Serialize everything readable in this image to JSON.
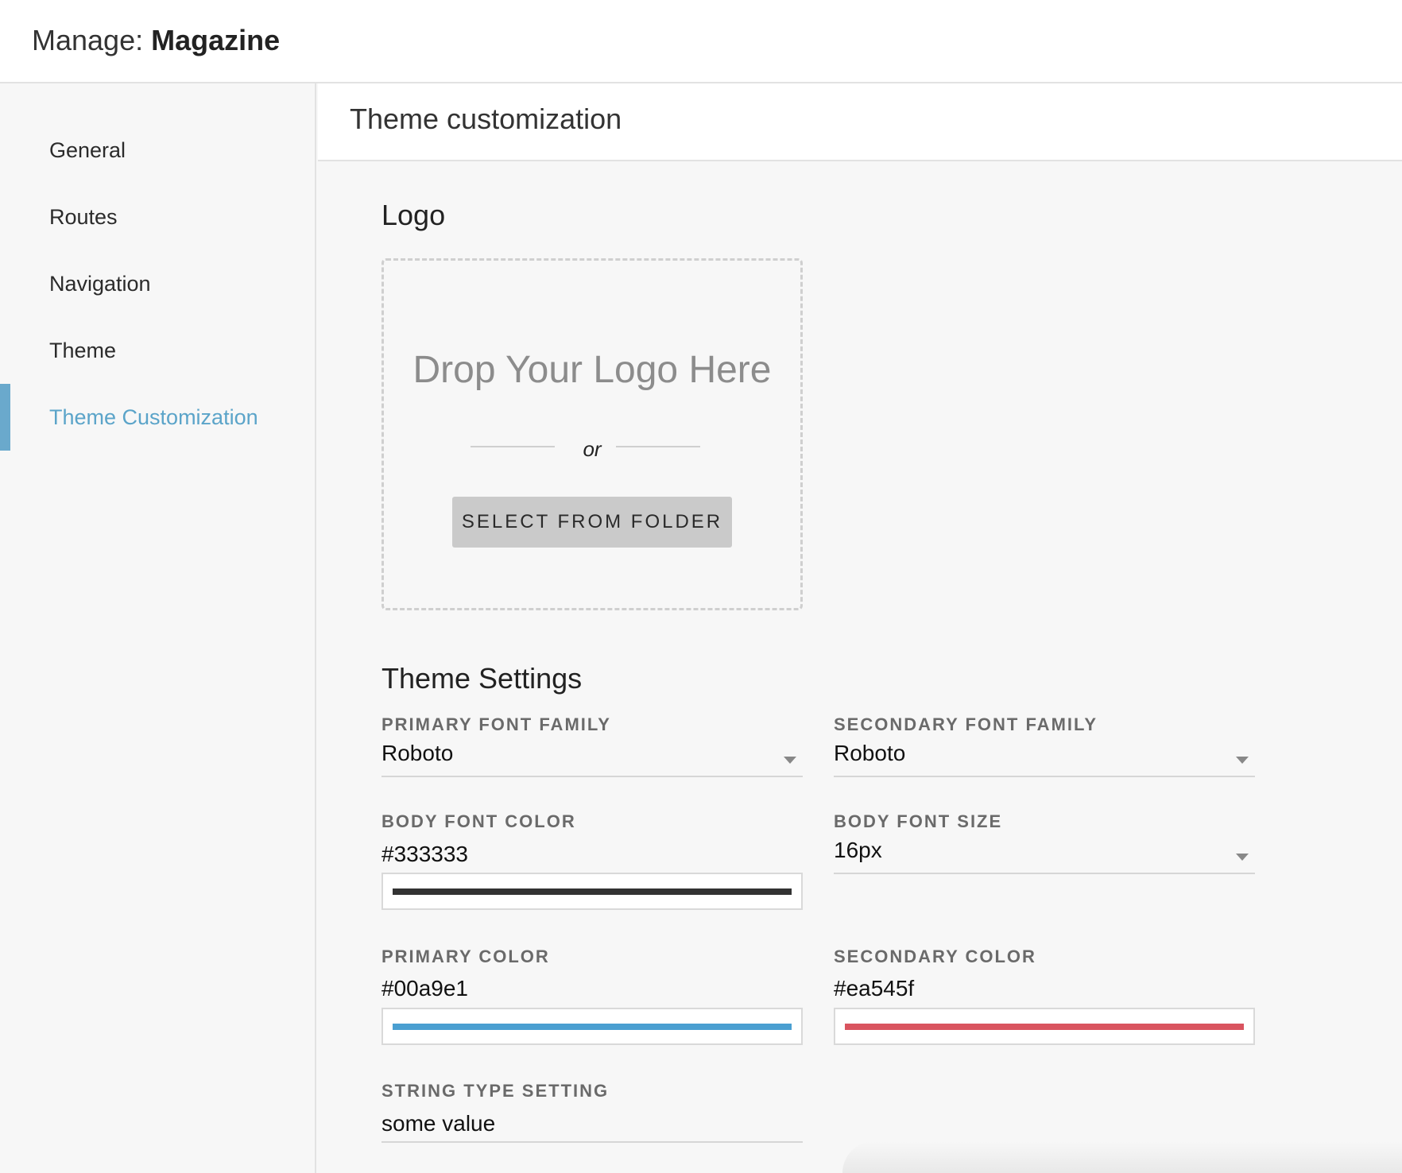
{
  "header": {
    "prefix": "Manage: ",
    "app_name": "Magazine"
  },
  "sidebar": {
    "items": [
      {
        "label": "General",
        "active": false
      },
      {
        "label": "Routes",
        "active": false
      },
      {
        "label": "Navigation",
        "active": false
      },
      {
        "label": "Theme",
        "active": false
      },
      {
        "label": "Theme Customization",
        "active": true
      }
    ]
  },
  "content": {
    "page_title": "Theme customization",
    "logo": {
      "section_title": "Logo",
      "drop_text": "Drop Your Logo Here",
      "or_text": "or",
      "select_button": "SELECT FROM FOLDER"
    },
    "settings": {
      "section_title": "Theme Settings",
      "primary_font_family": {
        "label": "PRIMARY FONT FAMILY",
        "value": "Roboto"
      },
      "secondary_font_family": {
        "label": "SECONDARY FONT FAMILY",
        "value": "Roboto"
      },
      "body_font_color": {
        "label": "BODY FONT COLOR",
        "value": "#333333",
        "swatch": "#333333"
      },
      "body_font_size": {
        "label": "BODY FONT SIZE",
        "value": "16px"
      },
      "primary_color": {
        "label": "PRIMARY COLOR",
        "value": "#00a9e1",
        "swatch": "#4a9fd1"
      },
      "secondary_color": {
        "label": "SECONDARY COLOR",
        "value": "#ea545f",
        "swatch": "#d9545f"
      },
      "string_type_setting": {
        "label": "STRING TYPE SETTING",
        "value": "some value"
      }
    }
  },
  "colors": {
    "accent": "#5ba4c9",
    "active_bar": "#6aa9cc"
  },
  "icons": {
    "dropdown": "chevron-down-icon"
  }
}
